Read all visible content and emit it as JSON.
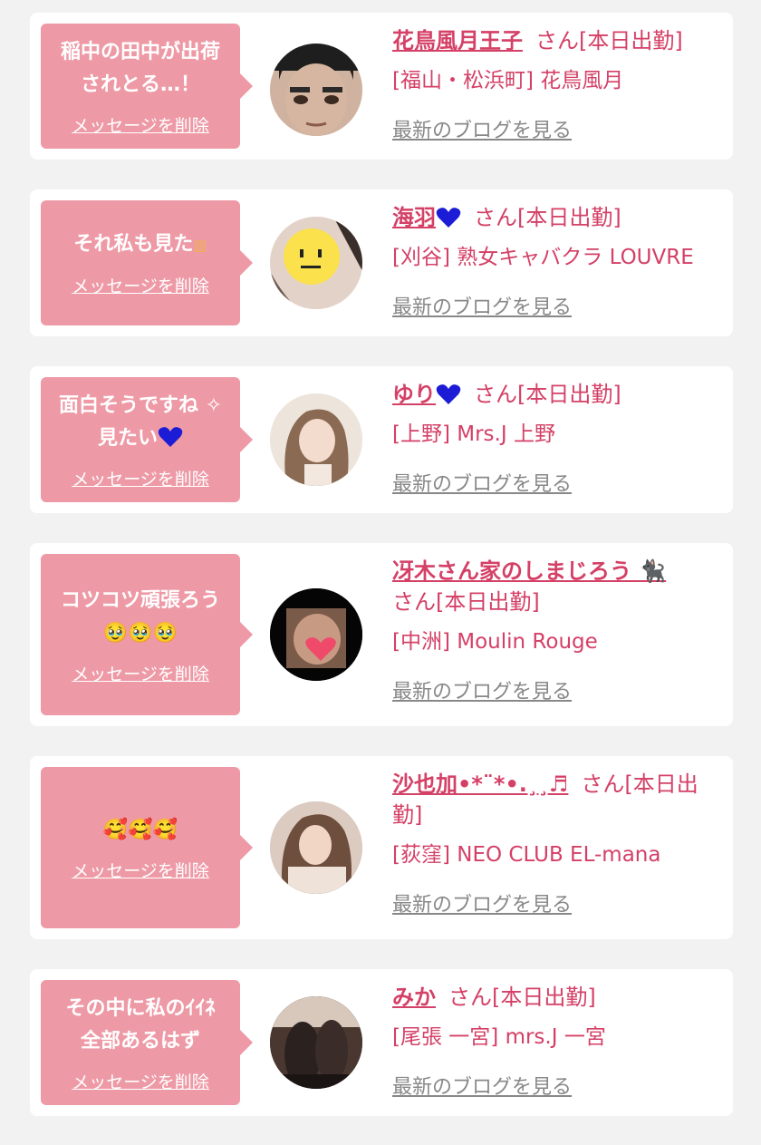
{
  "colors": {
    "bubble": "#ee9aa6",
    "name": "#d44066",
    "link": "#888888",
    "background": "#f2f2f2"
  },
  "common": {
    "delete_label": "メッセージを削除",
    "blog_label": "最新のブログを見る"
  },
  "cards": [
    {
      "message": "稲中の田中が出荷\nされとる…！",
      "name": "花鳥風月王子",
      "status": "さん[本日出勤]",
      "shop": "[福山・松浜町] 花鳥風月",
      "avatar_icon": "man-face-avatar"
    },
    {
      "message": "それ私も見た",
      "name": "海羽",
      "status": "さん[本日出勤]",
      "shop": "[刈谷] 熟女キャバクラ LOUVRE",
      "avatar_icon": "smiley-face-avatar"
    },
    {
      "message": "面白そうですね ✧\n見たい",
      "name": "ゆり",
      "status": "さん[本日出勤]",
      "shop": "[上野] Mrs.J 上野",
      "avatar_icon": "woman-photo-avatar"
    },
    {
      "message": "コツコツ頑張ろう\n🥹🥹🥹",
      "name": "冴木さん家のしまじろう 🐈‍⬛",
      "status": "さん[本日出勤]",
      "shop": "[中洲] Moulin Rouge",
      "avatar_icon": "heart-sticker-avatar"
    },
    {
      "message": "🥰🥰🥰",
      "name": "沙也加•*¨*•.¸¸♬",
      "status": "さん[本日出勤]",
      "shop": "[荻窪] NEO CLUB EL-mana",
      "avatar_icon": "woman-photo-avatar"
    },
    {
      "message": "その中に私のｲｲﾈ\n全部あるはず",
      "name": "みか",
      "status": "さん[本日出勤]",
      "shop": "[尾張 一宮] mrs.J 一宮",
      "avatar_icon": "legs-photo-avatar"
    }
  ]
}
